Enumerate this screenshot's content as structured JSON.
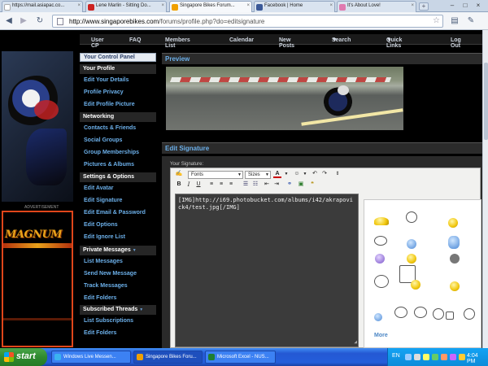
{
  "browser": {
    "tabs": [
      {
        "title": "https://mail.asiapac.co...",
        "active": false,
        "icon_color": "#ffffff"
      },
      {
        "title": "Lene Marlin - Sitting Do...",
        "active": false,
        "icon_color": "#cc2222"
      },
      {
        "title": "Singapore Bikes Forum...",
        "active": true,
        "icon_color": "#f0a000"
      },
      {
        "title": "Facebook | Home",
        "active": false,
        "icon_color": "#3b5998"
      },
      {
        "title": "It's About Love!",
        "active": false,
        "icon_color": "#e07ab0"
      }
    ],
    "window_controls": [
      "–",
      "□",
      "×"
    ],
    "url_domain": "http://www.singaporebikes.com",
    "url_path": "/forums/profile.php?do=editsignature",
    "icons": {
      "back": "back-arrow-icon",
      "forward": "forward-arrow-icon",
      "reload": "reload-icon",
      "star": "bookmark-star-icon",
      "page": "page-menu-icon",
      "tools": "wrench-icon"
    }
  },
  "top_nav": [
    {
      "label": "User CP",
      "caret": false
    },
    {
      "label": "FAQ",
      "caret": false
    },
    {
      "label": "Members List",
      "caret": false
    },
    {
      "label": "Calendar",
      "caret": false
    },
    {
      "label": "New Posts",
      "caret": false
    },
    {
      "label": "Search",
      "caret": true
    },
    {
      "label": "Quick Links",
      "caret": true
    },
    {
      "label": "Log Out",
      "caret": false
    }
  ],
  "sidebar": {
    "title": "Your Control Panel",
    "sections": [
      {
        "label": "Your Profile",
        "caret": false,
        "links": [
          "Edit Your Details",
          "Profile Privacy",
          "Edit Profile Picture"
        ]
      },
      {
        "label": "Networking",
        "caret": false,
        "links": [
          "Contacts & Friends",
          "Social Groups",
          "Group Memberships",
          "Pictures & Albums"
        ]
      },
      {
        "label": "Settings & Options",
        "caret": false,
        "links": [
          "Edit Avatar",
          "Edit Signature",
          "Edit Email & Password",
          "Edit Options",
          "Edit Ignore List"
        ]
      },
      {
        "label": "Private Messages",
        "caret": true,
        "links": [
          "List Messages",
          "Send New Message",
          "Track Messages",
          "Edit Folders"
        ]
      },
      {
        "label": "Subscribed Threads",
        "caret": true,
        "links": [
          "List Subscriptions",
          "Edit Folders"
        ]
      }
    ]
  },
  "ad": {
    "label": "ADVERTISEMENT",
    "brand": "MAGNUM"
  },
  "preview": {
    "title": "Preview"
  },
  "signature": {
    "title": "Edit Signature",
    "label": "Your Signature:",
    "font_select": "Fonts",
    "size_select": "Sizes",
    "text": "[IMG]http://i69.photobucket.com/albums/i42/akrapovick4/test.jpg[/IMG]",
    "more_label": "More"
  },
  "taskbar": {
    "start": "start",
    "tasks": [
      {
        "label": "Windows Live Messen...",
        "active": false,
        "icon_color": "#3bb3f0"
      },
      {
        "label": "Singapore Bikes Foru...",
        "active": true,
        "icon_color": "#f0a000"
      },
      {
        "label": "Microsoft Excel - NUS...",
        "active": false,
        "icon_color": "#1e7e34"
      }
    ],
    "language": "EN",
    "clock": "4:04 PM"
  }
}
